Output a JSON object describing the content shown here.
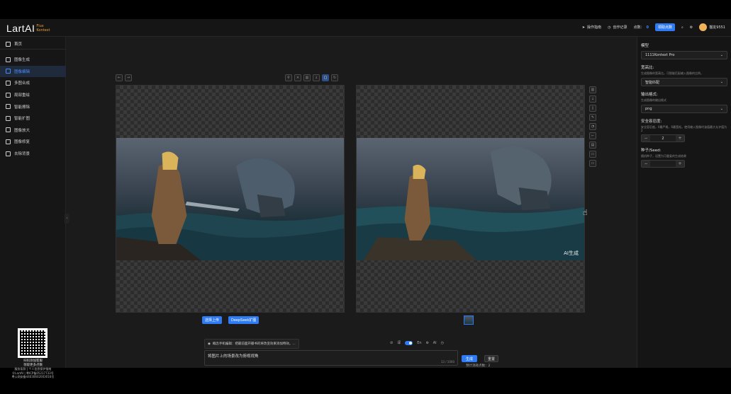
{
  "brand": {
    "name": "LartAI",
    "sub1": "Flux",
    "sub2": "Kontext",
    "accent": "#e6a23c"
  },
  "topbar": {
    "guide": "操作指南",
    "history": "创作记录",
    "points_label": "点数：",
    "points": "0",
    "claim": "领取点数",
    "user": "猫友9551"
  },
  "sidebar": {
    "home": "首页",
    "items": [
      {
        "label": "图像生成",
        "icon": "image-icon"
      },
      {
        "label": "图像编辑",
        "icon": "edit-icon"
      },
      {
        "label": "多图合成",
        "icon": "layers-icon"
      },
      {
        "label": "局部重绘",
        "icon": "brush-icon"
      },
      {
        "label": "智能擦除",
        "icon": "eraser-icon"
      },
      {
        "label": "智能扩图",
        "icon": "expand-icon"
      },
      {
        "label": "图像放大",
        "icon": "zoom-icon"
      },
      {
        "label": "图像修复",
        "icon": "repair-icon"
      },
      {
        "label": "去除背景",
        "icon": "cutout-icon"
      }
    ],
    "active_index": 1,
    "footer": {
      "line1": "扫码添加客服",
      "line2": "领取更多点数",
      "line3": "服务条款 | 个人信息保护指南",
      "line4": "©LartAI | 粤ICP备05217733号",
      "line5": "粤公网安备44030602003016号"
    }
  },
  "panel": {
    "model_label": "模型",
    "model_value": "1111Kontext Pro",
    "ratio_label": "宽高比:",
    "ratio_desc": "生成图像的宽高比。可智能匹配输入图像的比例。",
    "ratio_value": "智能匹配",
    "format_label": "输出格式:",
    "format_desc": "生成图像的输出格式",
    "format_value": "png",
    "safety_label": "安全容忍度:",
    "safety_desc": "安全容忍度。0最严格，6最宽松。使用输入图像时该值最大允许值为2",
    "safety_value": "2",
    "seed_label": "种子/Seed:",
    "seed_desc": "随机种子，设置为可重复的生成结果",
    "seed_value": ""
  },
  "workspace": {
    "watermark": "AI生成",
    "upload_btn": "选择上传",
    "deepseek_btn": "DeepSeek扩图",
    "hint": "概念手机编辑：把最前面开瓣书的将改变效果添加特效。...",
    "opt_lang": "En",
    "opt_ai": "AI",
    "prompt": "将图片上的场景改为俯视视角",
    "counter": "13 / 1000",
    "generate": "生成",
    "reset": "重置",
    "cost_label": "预计消耗点数：",
    "cost_value": "2"
  }
}
